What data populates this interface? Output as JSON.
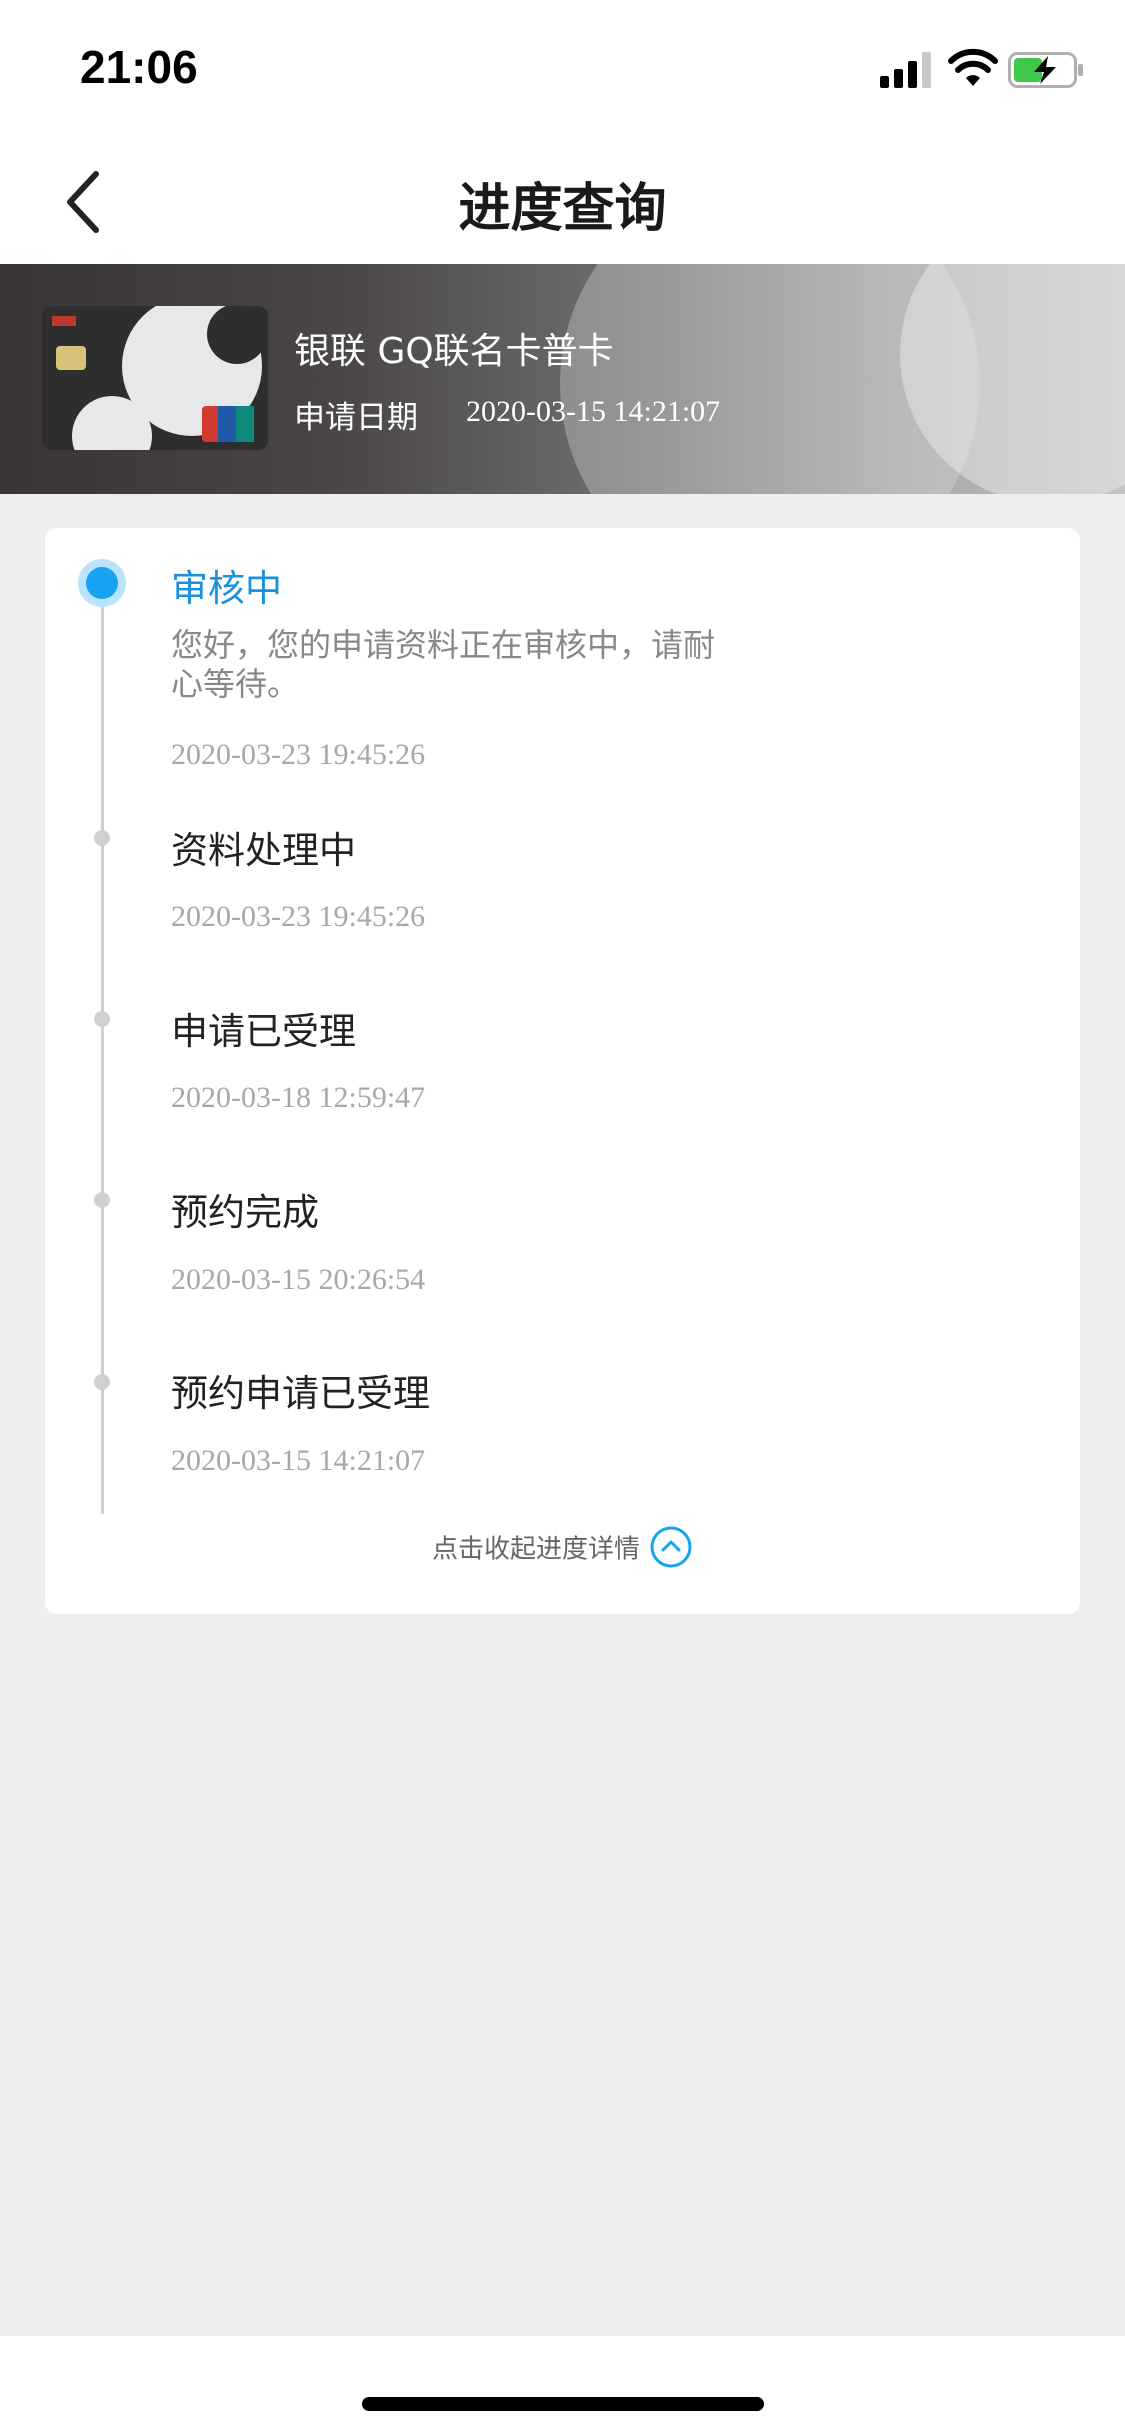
{
  "status_bar": {
    "time": "21:06"
  },
  "nav": {
    "title": "进度查询"
  },
  "card": {
    "name": "银联 GQ联名卡普卡",
    "apply_date_label": "申请日期",
    "apply_date": "2020-03-15 14:21:07"
  },
  "progress": {
    "steps": [
      {
        "title": "审核中",
        "description": "您好，您的申请资料正在审核中，请耐心等待。",
        "time": "2020-03-23 19:45:26",
        "active": true
      },
      {
        "title": "资料处理中",
        "time": "2020-03-23 19:45:26",
        "active": false
      },
      {
        "title": "申请已受理",
        "time": "2020-03-18 12:59:47",
        "active": false
      },
      {
        "title": "预约完成",
        "time": "2020-03-15 20:26:54",
        "active": false
      },
      {
        "title": "预约申请已受理",
        "time": "2020-03-15 14:21:07",
        "active": false
      }
    ],
    "collapse_label": "点击收起进度详情"
  },
  "colors": {
    "accent": "#18a2f2",
    "active_title": "#1a90e0",
    "background": "#eeeeee"
  },
  "icons": {
    "back": "chevron-left-icon",
    "collapse": "chevron-up-circle-icon"
  }
}
